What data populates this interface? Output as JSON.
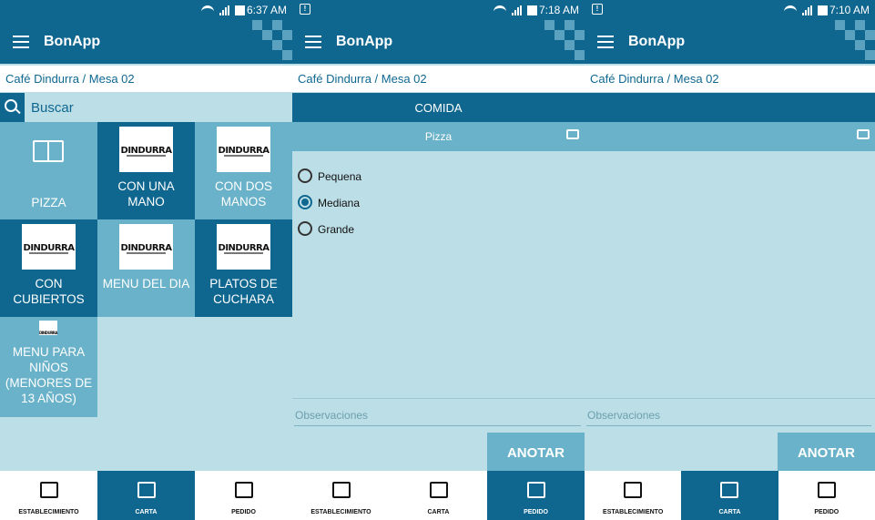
{
  "screens": [
    {
      "status": {
        "time": "6:37 AM"
      },
      "appbar": {
        "title": "BonApp"
      },
      "breadcrumb": "Café Dindurra / Mesa 02",
      "search": {
        "placeholder": "Buscar"
      },
      "tiles": [
        {
          "label": "PIZZA",
          "icon": "book-icon"
        },
        {
          "label": "CON UNA MANO",
          "logo": "DINDURRA"
        },
        {
          "label": "CON DOS MANOS",
          "logo": "DINDURRA"
        },
        {
          "label": "CON CUBIERTOS",
          "logo": "DINDURRA"
        },
        {
          "label": "MENU DEL DIA",
          "logo": "DINDURRA"
        },
        {
          "label": "PLATOS DE CUCHARA",
          "logo": "DINDURRA"
        },
        {
          "label": "MENU PARA NIÑOS (MENORES DE 13 AÑOS)",
          "logo": "DINDURRA"
        }
      ],
      "nav": {
        "active": "CARTA"
      }
    },
    {
      "status": {
        "time": "7:18 AM"
      },
      "appbar": {
        "title": "BonApp"
      },
      "breadcrumb": "Café Dindurra / Mesa 02",
      "tab": "COMIDA",
      "subheader": "Pizza",
      "options": [
        {
          "label": "Pequena",
          "checked": false
        },
        {
          "label": "Mediana",
          "checked": true
        },
        {
          "label": "Grande",
          "checked": false
        }
      ],
      "observaciones_placeholder": "Observaciones",
      "anotar": "ANOTAR",
      "nav": {
        "active": "PEDIDO"
      }
    },
    {
      "status": {
        "time": "7:10 AM"
      },
      "appbar": {
        "title": "BonApp"
      },
      "breadcrumb": "Café Dindurra / Mesa 02",
      "observaciones_placeholder": "Observaciones",
      "anotar": "ANOTAR",
      "nav": {
        "active": "CARTA"
      }
    }
  ],
  "nav_items": [
    "ESTABLECIMIENTO",
    "CARTA",
    "PEDIDO"
  ],
  "colors": {
    "primary": "#0f6790",
    "secondary": "#6ab2c9",
    "background": "#bcdee6"
  }
}
